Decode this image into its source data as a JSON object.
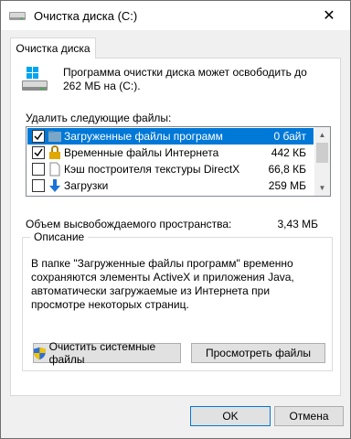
{
  "window": {
    "title": "Очистка диска  (C:)",
    "close_glyph": "✕"
  },
  "tabs": [
    {
      "label": "Очистка диска"
    }
  ],
  "intro": {
    "text": "Программа очистки диска может освободить до 262 МБ на  (C:)."
  },
  "files": {
    "label": "Удалить следующие файлы:",
    "items": [
      {
        "name": "Загруженные файлы программ",
        "size": "0 байт",
        "checked": true,
        "selected": true,
        "icon": "folder-icon"
      },
      {
        "name": "Временные файлы Интернета",
        "size": "442 КБ",
        "checked": true,
        "selected": false,
        "icon": "lock-icon"
      },
      {
        "name": "Кэш построителя текстуры DirectX",
        "size": "66,8 КБ",
        "checked": false,
        "selected": false,
        "icon": "file-icon"
      },
      {
        "name": "Загрузки",
        "size": "259 МБ",
        "checked": false,
        "selected": false,
        "icon": "download-arrow-icon"
      }
    ]
  },
  "space": {
    "label": "Объем высвобождаемого пространства:",
    "value": "3,43 МБ"
  },
  "description": {
    "legend": "Описание",
    "text": "В папке \"Загруженные файлы программ\" временно сохраняются элементы ActiveX и приложения Java, автоматически загружаемые из Интернета при просмотре некоторых страниц."
  },
  "buttons": {
    "cleanup_system": "Очистить системные файлы",
    "view_files": "Просмотреть файлы",
    "ok": "OK",
    "cancel": "Отмена"
  },
  "colors": {
    "selection": "#0078d7",
    "window_bg": "#f0f0f0",
    "panel_bg": "#ffffff"
  }
}
